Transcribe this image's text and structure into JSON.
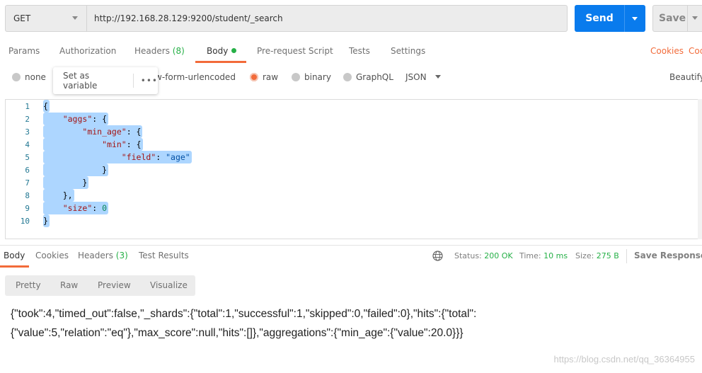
{
  "request": {
    "method": "GET",
    "url": "http://192.168.28.129:9200/student/_search",
    "send_label": "Send",
    "save_label": "Save"
  },
  "tabs": [
    {
      "label": "Params"
    },
    {
      "label": "Authorization"
    },
    {
      "label": "Headers",
      "count": "(8)"
    },
    {
      "label": "Body",
      "active": true
    },
    {
      "label": "Pre-request Script"
    },
    {
      "label": "Tests"
    },
    {
      "label": "Settings"
    }
  ],
  "cookies_label": "Cookies",
  "code_label": "Code",
  "body_options": {
    "none": "none",
    "urlencoded": "x-www-form-urlencoded",
    "raw": "raw",
    "binary": "binary",
    "graphql": "GraphQL",
    "format": "JSON",
    "beautify": "Beautify",
    "selected": "raw"
  },
  "popup": {
    "set_variable": "Set as variable",
    "more": "•••"
  },
  "editor": {
    "lines": [
      [
        [
          "punc",
          "{"
        ]
      ],
      [
        [
          "punc",
          "    "
        ],
        [
          "key",
          "\"aggs\""
        ],
        [
          "punc",
          ": {"
        ]
      ],
      [
        [
          "punc",
          "        "
        ],
        [
          "key",
          "\"min_age\""
        ],
        [
          "punc",
          ": {"
        ]
      ],
      [
        [
          "punc",
          "            "
        ],
        [
          "key",
          "\"min\""
        ],
        [
          "punc",
          ": {"
        ]
      ],
      [
        [
          "punc",
          "                "
        ],
        [
          "key",
          "\"field\""
        ],
        [
          "punc",
          ": "
        ],
        [
          "str",
          "\"age\""
        ]
      ],
      [
        [
          "punc",
          "            }"
        ]
      ],
      [
        [
          "punc",
          "        }"
        ]
      ],
      [
        [
          "punc",
          "    },"
        ]
      ],
      [
        [
          "punc",
          "    "
        ],
        [
          "key",
          "\"size\""
        ],
        [
          "punc",
          ": "
        ],
        [
          "num",
          "0"
        ]
      ],
      [
        [
          "punc",
          "}"
        ]
      ]
    ]
  },
  "response": {
    "tabs": [
      {
        "label": "Body",
        "active": true
      },
      {
        "label": "Cookies"
      },
      {
        "label": "Headers",
        "count": "(3)"
      },
      {
        "label": "Test Results"
      }
    ],
    "status_label": "Status:",
    "status": "200 OK",
    "time_label": "Time:",
    "time": "10 ms",
    "size_label": "Size:",
    "size": "275 B",
    "save_response": "Save Response",
    "views": [
      "Pretty",
      "Raw",
      "Preview",
      "Visualize"
    ],
    "body_line1": "{\"took\":4,\"timed_out\":false,\"_shards\":{\"total\":1,\"successful\":1,\"skipped\":0,\"failed\":0},\"hits\":{\"total\":",
    "body_line2": "{\"value\":5,\"relation\":\"eq\"},\"max_score\":null,\"hits\":[]},\"aggregations\":{\"min_age\":{\"value\":20.0}}}"
  },
  "watermark": "https://blog.csdn.net/qq_36364955",
  "colors": {
    "accent": "#f26b3a",
    "send": "#097bed",
    "success": "#26b047",
    "selection": "#add6ff"
  }
}
